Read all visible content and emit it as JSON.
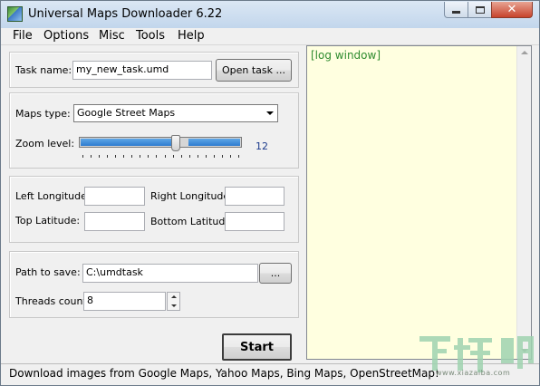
{
  "window": {
    "title": "Universal Maps Downloader 6.22",
    "minimize_icon": "minimize-icon",
    "maximize_icon": "maximize-icon",
    "close_icon": "close-icon",
    "close_glyph": "✕"
  },
  "menu": {
    "items": [
      "File",
      "Options",
      "Misc",
      "Tools",
      "Help"
    ]
  },
  "task": {
    "label": "Task name:",
    "value": "my_new_task.umd",
    "open_button": "Open task ..."
  },
  "maps": {
    "type_label": "Maps type:",
    "type_value": "Google Street Maps",
    "zoom_label": "Zoom level:",
    "zoom_value": "12",
    "zoom_fraction": 0.6
  },
  "coords": {
    "left_longitude_label": "Left Longitude:",
    "right_longitude_label": "Right Longitude:",
    "top_latitude_label": "Top Latitude:",
    "bottom_latitude_label": "Bottom Latitude:",
    "left_longitude_value": "",
    "right_longitude_value": "",
    "top_latitude_value": "",
    "bottom_latitude_value": ""
  },
  "save": {
    "path_label": "Path to save:",
    "path_value": "C:\\umdtask",
    "browse_button": "...",
    "threads_label": "Threads count:",
    "threads_value": "8"
  },
  "actions": {
    "start_button": "Start"
  },
  "log": {
    "text": "[log window]",
    "text_color": "#2e8b2e",
    "background": "#ffffe0"
  },
  "status": {
    "text": "Download images from Google Maps, Yahoo Maps, Bing Maps, OpenStreetMap!"
  },
  "watermark": {
    "logo_text": "下载吧",
    "url_text": "www.xiazaiba.com"
  }
}
